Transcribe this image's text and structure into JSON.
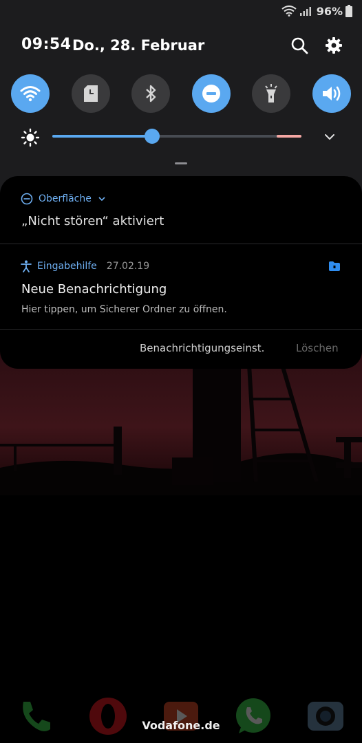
{
  "status_bar": {
    "battery": "96%"
  },
  "header": {
    "time": "09:54",
    "date": "Do., 28. Februar"
  },
  "quick_tiles": [
    {
      "name": "wifi",
      "state": "on"
    },
    {
      "name": "sd-card",
      "state": "off"
    },
    {
      "name": "bluetooth",
      "state": "off"
    },
    {
      "name": "do-not-disturb",
      "state": "on"
    },
    {
      "name": "flashlight",
      "state": "off"
    },
    {
      "name": "sound",
      "state": "on"
    }
  ],
  "brightness": {
    "level": 0.4
  },
  "notifications": {
    "dnd": {
      "app": "Oberfläche",
      "text": "„Nicht stören“ aktiviert"
    },
    "accessibility": {
      "app": "Eingabehilfe",
      "date": "27.02.19",
      "title": "Neue Benachrichtigung",
      "body": "Hier tippen, um Sicherer Ordner zu öffnen."
    },
    "actions": {
      "settings": "Benachrichtigungseinst.",
      "clear": "Löschen"
    }
  },
  "carrier": "Vodafone.de",
  "colors": {
    "accent": "#5aa8f0",
    "tile_off": "#3a3a3c",
    "panel": "#1c1c1e"
  }
}
